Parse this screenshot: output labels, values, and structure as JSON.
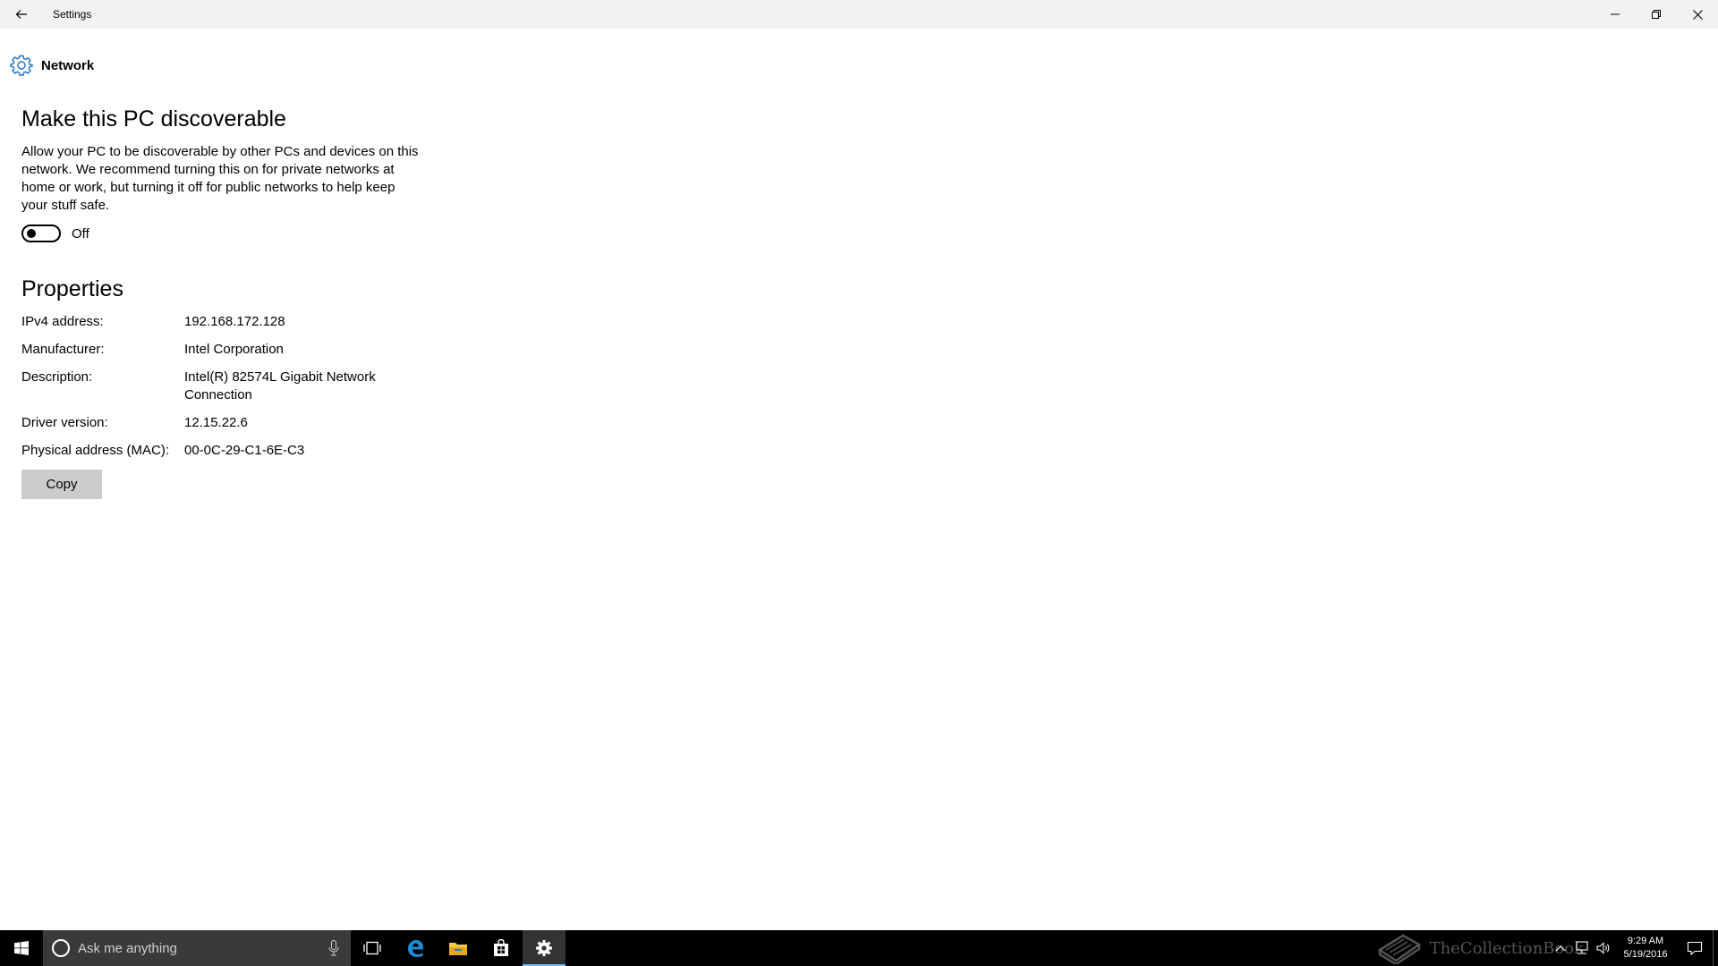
{
  "window": {
    "title": "Settings",
    "controls": {
      "minimize": "minimize-icon",
      "maximize": "restore-icon",
      "close": "close-icon"
    }
  },
  "page": {
    "icon": "gear-icon",
    "title": "Network"
  },
  "discoverable": {
    "heading": "Make this PC discoverable",
    "description": "Allow your PC to be discoverable by other PCs and devices on this network. We recommend turning this on for private networks at home or work, but turning it off for public networks to help keep your stuff safe.",
    "toggle_state": "Off",
    "toggle_on": false
  },
  "properties": {
    "heading": "Properties",
    "rows": [
      {
        "label": "IPv4 address:",
        "value": "192.168.172.128"
      },
      {
        "label": "Manufacturer:",
        "value": "Intel Corporation"
      },
      {
        "label": "Description:",
        "value": "Intel(R) 82574L Gigabit Network Connection"
      },
      {
        "label": "Driver version:",
        "value": "12.15.22.6"
      },
      {
        "label": "Physical address (MAC):",
        "value": "00-0C-29-C1-6E-C3"
      }
    ],
    "copy_label": "Copy"
  },
  "taskbar": {
    "search_placeholder": "Ask me anything",
    "apps": [
      "task-view-icon",
      "edge-icon",
      "file-explorer-icon",
      "store-icon",
      "settings-icon"
    ],
    "watermark": "TheCollectionBook",
    "clock": {
      "time": "9:29 AM",
      "date": "5/19/2016"
    },
    "accent_color": "#76b9ed"
  }
}
